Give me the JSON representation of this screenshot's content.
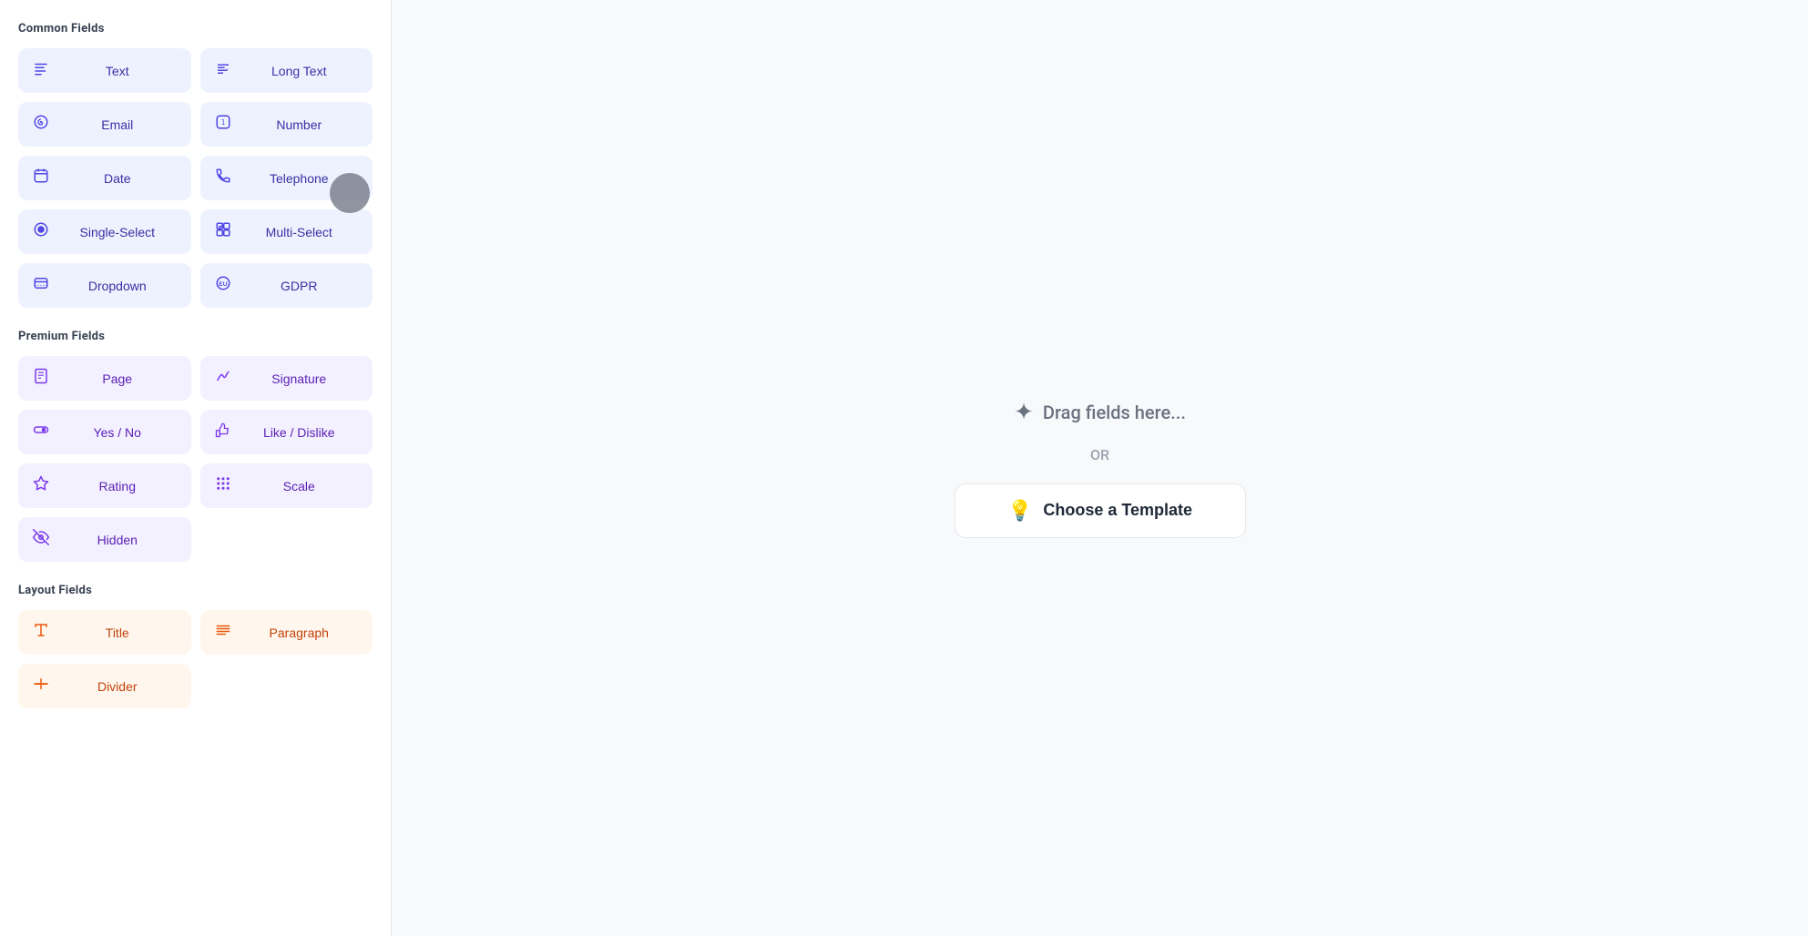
{
  "sections": {
    "common": {
      "title": "Common Fields",
      "fields": [
        {
          "id": "text",
          "label": "Text",
          "icon": "text",
          "col": 1
        },
        {
          "id": "long-text",
          "label": "Long Text",
          "icon": "long-text",
          "col": 2
        },
        {
          "id": "email",
          "label": "Email",
          "icon": "email",
          "col": 1
        },
        {
          "id": "number",
          "label": "Number",
          "icon": "number",
          "col": 2
        },
        {
          "id": "date",
          "label": "Date",
          "icon": "date",
          "col": 1
        },
        {
          "id": "telephone",
          "label": "Telephone",
          "icon": "telephone",
          "col": 2
        },
        {
          "id": "single-select",
          "label": "Single-Select",
          "icon": "single-select",
          "col": 1
        },
        {
          "id": "multi-select",
          "label": "Multi-Select",
          "icon": "multi-select",
          "col": 2
        },
        {
          "id": "dropdown",
          "label": "Dropdown",
          "icon": "dropdown",
          "col": 1
        },
        {
          "id": "gdpr",
          "label": "GDPR",
          "icon": "gdpr",
          "col": 2
        }
      ]
    },
    "premium": {
      "title": "Premium Fields",
      "fields": [
        {
          "id": "page",
          "label": "Page",
          "icon": "page",
          "col": 1
        },
        {
          "id": "signature",
          "label": "Signature",
          "icon": "signature",
          "col": 2
        },
        {
          "id": "yes-no",
          "label": "Yes / No",
          "icon": "yes-no",
          "col": 1
        },
        {
          "id": "like-dislike",
          "label": "Like / Dislike",
          "icon": "like-dislike",
          "col": 2
        },
        {
          "id": "rating",
          "label": "Rating",
          "icon": "rating",
          "col": 1
        },
        {
          "id": "scale",
          "label": "Scale",
          "icon": "scale",
          "col": 2
        },
        {
          "id": "hidden",
          "label": "Hidden",
          "icon": "hidden",
          "col": 1
        }
      ]
    },
    "layout": {
      "title": "Layout Fields",
      "fields": [
        {
          "id": "title",
          "label": "Title",
          "icon": "title",
          "col": 1
        },
        {
          "id": "paragraph",
          "label": "Paragraph",
          "icon": "paragraph",
          "col": 2
        },
        {
          "id": "divider",
          "label": "Divider",
          "icon": "divider",
          "col": 1
        }
      ]
    }
  },
  "canvas": {
    "drag_text": "Drag fields here...",
    "or_text": "OR",
    "template_btn_label": "Choose a Template"
  }
}
